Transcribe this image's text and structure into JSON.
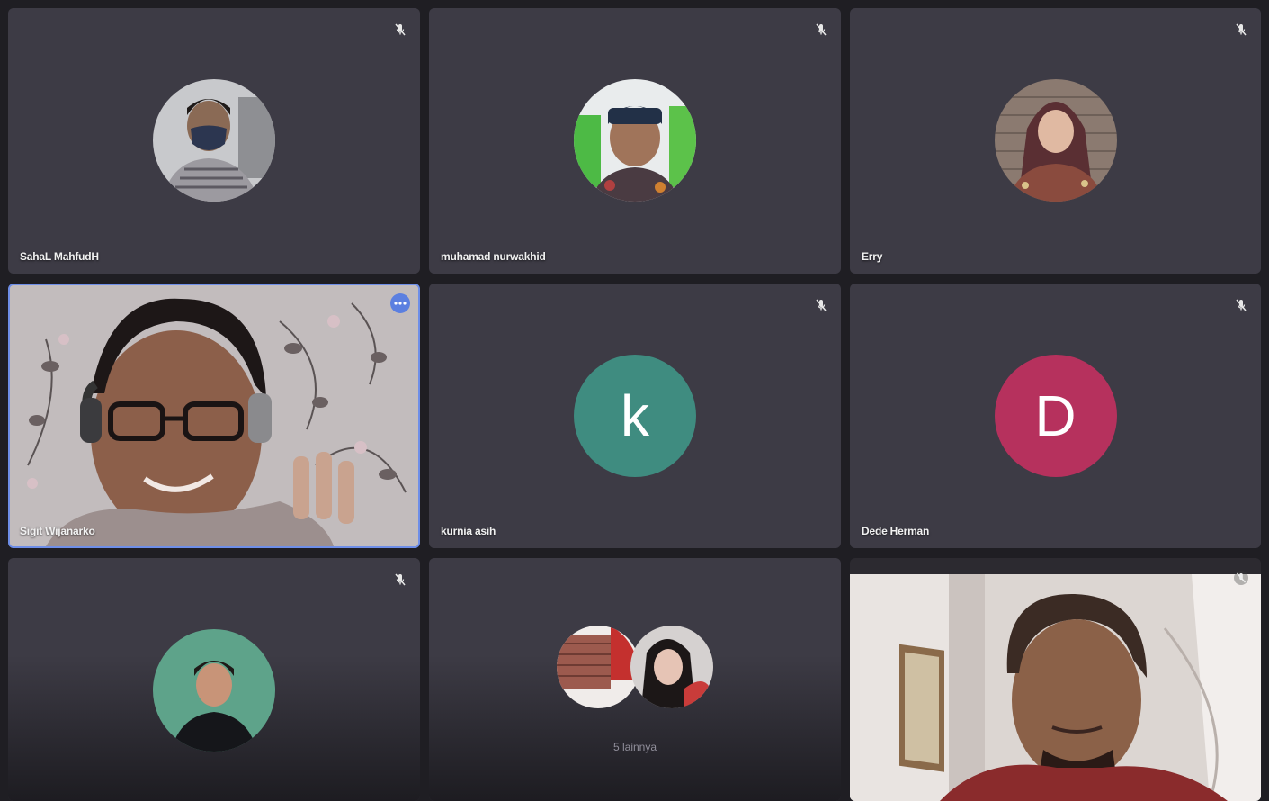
{
  "participants": [
    {
      "name": "SahaL MahfudH",
      "muted": true,
      "avatar": "photo",
      "avatar_desc_icon": "person-masked-avatar"
    },
    {
      "name": "muhamad nurwakhid",
      "muted": true,
      "avatar": "photo",
      "avatar_desc_icon": "person-cap-avatar"
    },
    {
      "name": "Erry",
      "muted": true,
      "avatar": "photo",
      "avatar_desc_icon": "person-hijab-avatar"
    },
    {
      "name": "Sigit Wijanarko",
      "muted": false,
      "speaking": true,
      "avatar": "video"
    },
    {
      "name": "kurnia asih",
      "muted": true,
      "avatar": "letter",
      "letter": "k",
      "color": "#3f8c80"
    },
    {
      "name": "Dede Herman",
      "muted": true,
      "avatar": "letter",
      "letter": "D",
      "color": "#b6315d"
    },
    {
      "name": "",
      "muted": true,
      "avatar": "photo",
      "avatar_desc_icon": "person-green-avatar"
    },
    {
      "name": "",
      "group": true,
      "others_label": "5 lainnya"
    },
    {
      "name": "",
      "muted": true,
      "avatar": "video"
    }
  ],
  "colors": {
    "tile_bg": "#3d3b45",
    "page_bg": "#1f1e23",
    "active_border": "#6e8ee8",
    "more_button": "#5b7fe0"
  },
  "icons": {
    "mute": "mic-off-icon",
    "more": "more-options-icon"
  }
}
